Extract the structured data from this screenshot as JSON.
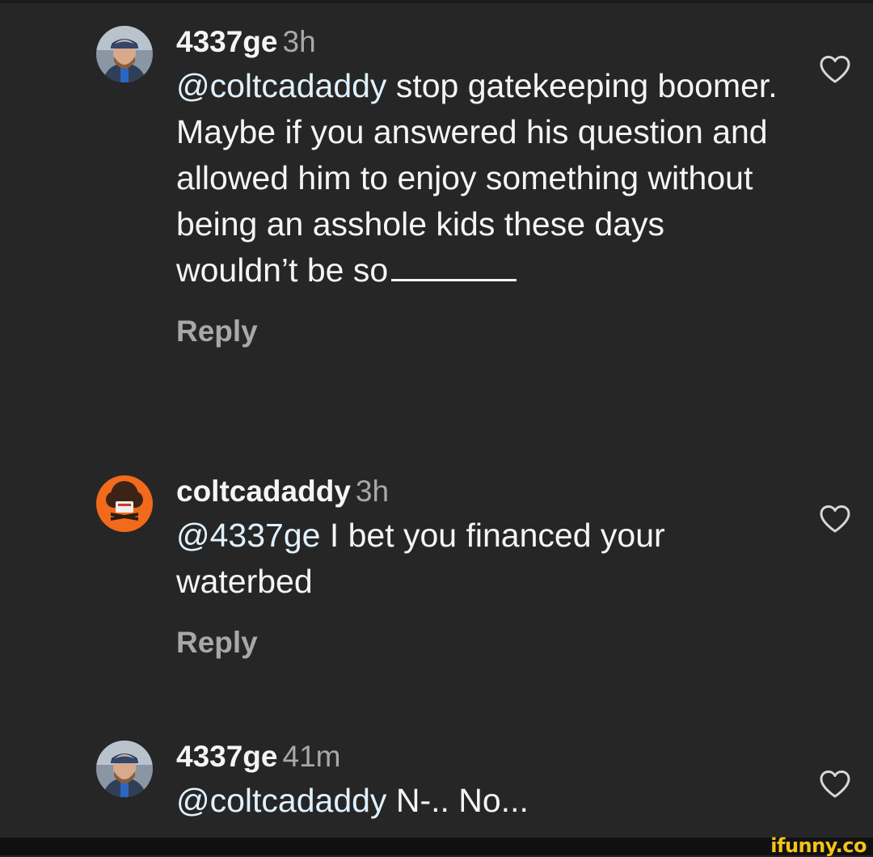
{
  "comments": [
    {
      "username": "4337ge",
      "time": "3h",
      "mention": "@coltcadaddy",
      "text_line1_rest": " stop gatekeeping",
      "text_rest": "boomer. Maybe if you answered his question and allowed him to enjoy something without being an asshole kids these days wouldn’t be so",
      "reply_label": "Reply",
      "avatar_icon": "profile-photo-man-cap-icon",
      "like_icon": "heart-outline-icon"
    },
    {
      "username": "coltcadaddy",
      "time": "3h",
      "mention": "@4337ge",
      "text_rest": " I bet you financed your waterbed",
      "reply_label": "Reply",
      "avatar_icon": "profile-photo-cartoon-orange-icon",
      "like_icon": "heart-outline-icon"
    },
    {
      "username": "4337ge",
      "time": "41m",
      "mention": "@coltcadaddy",
      "text_rest": " N-.. No...",
      "avatar_icon": "profile-photo-man-cap-icon",
      "like_icon": "heart-outline-icon"
    }
  ],
  "watermark": "ifunny.co",
  "colors": {
    "background": "#262626",
    "primary_text": "#f5f5f5",
    "secondary_text": "#a8a8a8",
    "mention": "#e0f1ff",
    "watermark": "#f4c21a"
  }
}
